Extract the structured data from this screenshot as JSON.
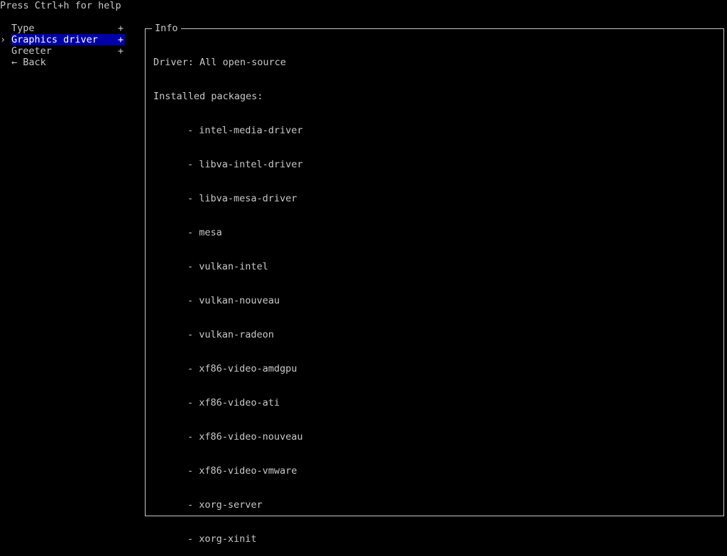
{
  "help_text": "Press Ctrl+h for help",
  "menu": {
    "cursor": "›",
    "items": [
      {
        "label": "Type",
        "suffix": "+"
      },
      {
        "label": "Graphics driver",
        "suffix": "+"
      },
      {
        "label": "Greeter",
        "suffix": "+"
      },
      {
        "label": "← Back",
        "suffix": ""
      }
    ]
  },
  "info": {
    "title": "Info",
    "driver_line": "Driver: All open-source",
    "installed_label": "Installed packages:",
    "packages": [
      "- intel-media-driver",
      "- libva-intel-driver",
      "- libva-mesa-driver",
      "- mesa",
      "- vulkan-intel",
      "- vulkan-nouveau",
      "- vulkan-radeon",
      "- xf86-video-amdgpu",
      "- xf86-video-ati",
      "- xf86-video-nouveau",
      "- xf86-video-vmware",
      "- xorg-server",
      "- xorg-xinit"
    ]
  },
  "colors": {
    "background": "#000000",
    "text": "#c8c8c8",
    "selection": "#0000a8",
    "selection_text": "#ffffff"
  }
}
